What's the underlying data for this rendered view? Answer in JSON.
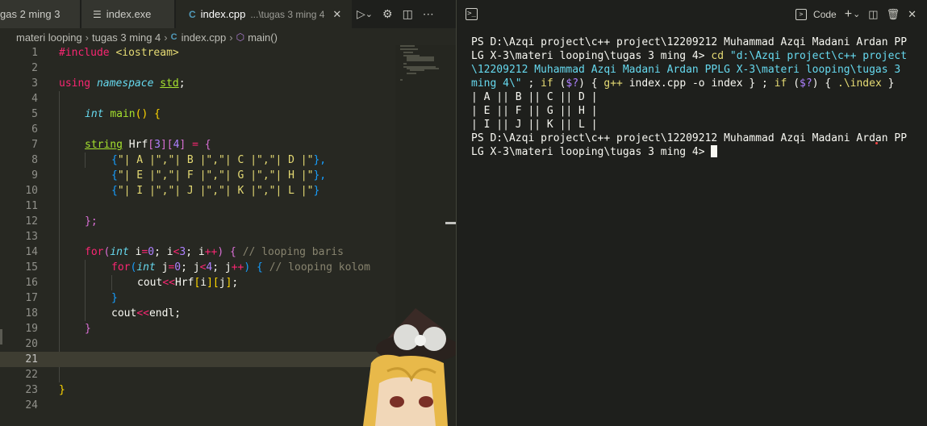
{
  "tabs": [
    {
      "label": "gas 2 ming 3",
      "state": "inactive"
    },
    {
      "label": "index.exe",
      "state": "inactive"
    },
    {
      "label": "index.cpp",
      "description": "...\\tugas 3 ming 4",
      "state": "active"
    }
  ],
  "tab_actions": {
    "run": "▷",
    "dropdown": "⌄",
    "settings": "⚙",
    "split": "◫",
    "more": "⋯"
  },
  "breadcrumb": [
    "materi looping",
    "tugas 3 ming 4",
    "index.cpp",
    "main()"
  ],
  "code_lines": [
    {
      "n": "1"
    },
    {
      "n": "2"
    },
    {
      "n": "3"
    },
    {
      "n": "4"
    },
    {
      "n": "5"
    },
    {
      "n": "6"
    },
    {
      "n": "7"
    },
    {
      "n": "8"
    },
    {
      "n": "9"
    },
    {
      "n": "10"
    },
    {
      "n": "11"
    },
    {
      "n": "12"
    },
    {
      "n": "13"
    },
    {
      "n": "14"
    },
    {
      "n": "15"
    },
    {
      "n": "16"
    },
    {
      "n": "17"
    },
    {
      "n": "18"
    },
    {
      "n": "19"
    },
    {
      "n": "20"
    },
    {
      "n": "21"
    },
    {
      "n": "22"
    },
    {
      "n": "23"
    },
    {
      "n": "24"
    }
  ],
  "code": {
    "l1": {
      "a": "#include ",
      "b": "<iostream>"
    },
    "l3": {
      "a": "using",
      "b": "namespace",
      "c": "std",
      "d": ";"
    },
    "l5": {
      "a": "int",
      "b": "main",
      "c": "()",
      "d": "{"
    },
    "l7": {
      "a": "string",
      "b": " Hrf",
      "c": "[",
      "d": "3",
      "e": "][",
      "f": "4",
      "g": "]",
      "h": " = ",
      "i": "{"
    },
    "l8": {
      "a": "{",
      "b": "\"| A |\",\"| B |\",\"| C |\",\"| D |\"",
      "c": "},"
    },
    "l9": {
      "a": "{",
      "b": "\"| E |\",\"| F |\",\"| G |\",\"| H |\"",
      "c": "},"
    },
    "l10": {
      "a": "{",
      "b": "\"| I |\",\"| J |\",\"| K |\",\"| L |\"",
      "c": "}"
    },
    "l12": {
      "a": "};"
    },
    "l14": {
      "a": "for",
      "b": "(",
      "c": "int",
      "d": " i",
      "e": "=",
      "f": "0",
      "g": "; i",
      "h": "<",
      "i": "3",
      "j": "; i",
      "k": "++",
      "l": ")",
      "m": " {",
      "n": " // looping baris"
    },
    "l15": {
      "a": "for",
      "b": "(",
      "c": "int",
      "d": " j",
      "e": "=",
      "f": "0",
      "g": "; j",
      "h": "<",
      "i": "4",
      "j": "; j",
      "k": "++",
      "l": ")",
      "m": " {",
      "n": " // looping kolom"
    },
    "l16": {
      "a": "cout",
      "b": "<<",
      "c": "Hrf",
      "d": "[",
      "e": "i",
      "f": "][",
      "g": "j",
      "h": "]",
      "i": ";"
    },
    "l17": {
      "a": "}"
    },
    "l18": {
      "a": "cout",
      "b": "<<",
      "c": "endl",
      "d": ";"
    },
    "l19": {
      "a": "}"
    },
    "l23": {
      "a": "}"
    }
  },
  "panel": {
    "terminal_label": "Code",
    "actions": {
      "add": "+",
      "chev": "⌄",
      "split": "◫",
      "trash": "🗑",
      "close": "✕"
    }
  },
  "terminal": {
    "l1": "PS D:\\Azqi project\\c++ project\\12209212 Muhammad Azqi Madani Ardan PP",
    "l2a": "LG X-3\\materi looping\\tugas 3 ming 4> ",
    "l2b": "cd",
    "l2c": " \"d:\\Azqi project\\c++ project",
    "l3": "\\12209212 Muhammad Azqi Madani Ardan PPLG X-3\\materi looping\\tugas 3",
    "l4a": "ming 4\\\"",
    "l4b": " ; ",
    "l4c": "if",
    "l4d": " (",
    "l4e": "$?",
    "l4f": ") { ",
    "l4g": "g++",
    "l4h": " index.cpp -o index } ; ",
    "l4i": "if",
    "l4j": " (",
    "l4k": "$?",
    "l4l": ") { ",
    "l4m": ".\\index",
    "l4n": " }",
    "l5": "| A || B || C || D |",
    "l6": "| E || F || G || H |",
    "l7": "| I || J || K || L |",
    "l8": "PS D:\\Azqi project\\c++ project\\12209212 Muhammad Azqi Madani Ardan PP",
    "l9": "LG X-3\\materi looping\\tugas 3 ming 4> "
  }
}
